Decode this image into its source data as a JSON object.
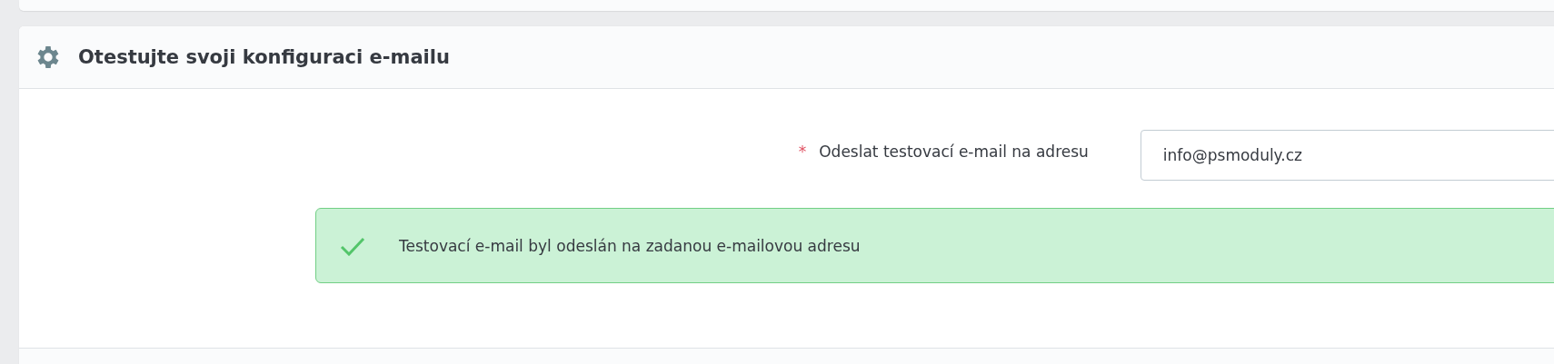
{
  "panel": {
    "title": "Otestujte svoji konfiguraci e-mailu"
  },
  "field": {
    "label": "Odeslat testovací e-mail na adresu",
    "required": true,
    "required_mark": "*",
    "value": "info@psmoduly.cz"
  },
  "alert": {
    "kind": "success",
    "message": "Testovací e-mail byl odeslán na zadanou e-mailovou adresu"
  }
}
